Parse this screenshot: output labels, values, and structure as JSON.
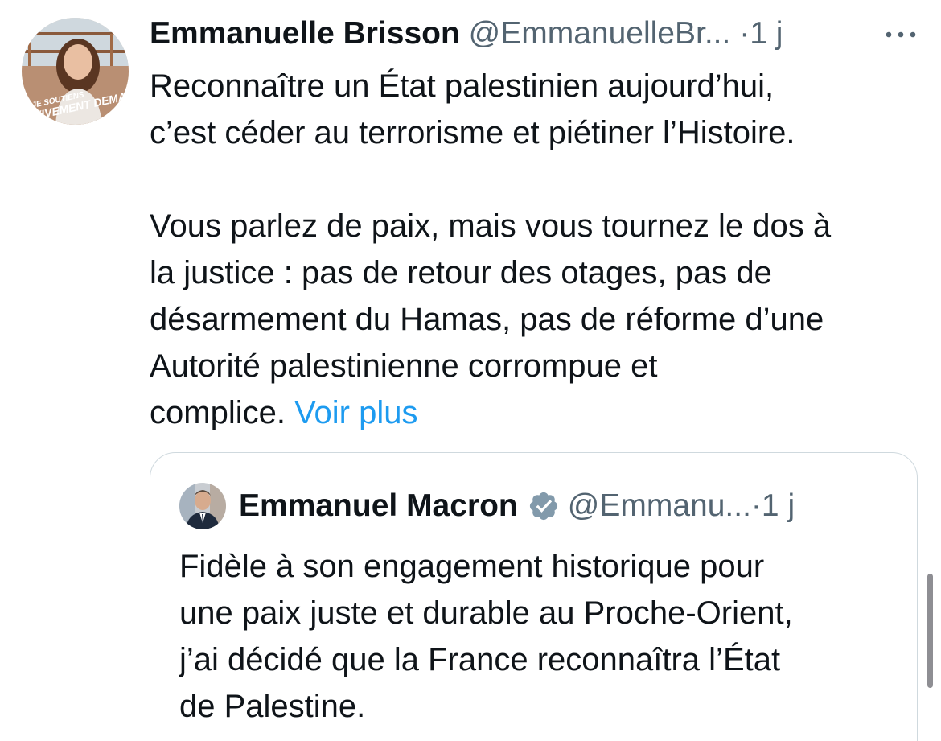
{
  "tweet": {
    "author_name": "Emmanuelle Brisson",
    "author_handle": "@EmmanuelleBr...",
    "separator": "·",
    "timestamp": "1 j",
    "avatar_banner": "JE SOUTIENS VIVEMENT DEMAIN !",
    "paragraph_1_line_1": "Reconnaître un État palestinien aujourd’hui,",
    "paragraph_1_line_2": "c’est céder au terrorisme et piétiner l’Histoire.",
    "paragraph_2_line_1": "Vous parlez de paix, mais vous tournez le dos à",
    "paragraph_2_line_2": "la justice : pas de retour des otages, pas de",
    "paragraph_2_line_3": "désarmement du Hamas, pas de réforme d’une",
    "paragraph_2_line_4": "Autorité palestinienne corrompue et",
    "paragraph_2_line_5": "complice.",
    "show_more_label": "Voir plus",
    "more_icon": "more-horizontal-icon"
  },
  "quoted_tweet": {
    "author_name": "Emmanuel Macron",
    "author_handle": "@Emmanu...",
    "separator": "·",
    "timestamp": "1 j",
    "verified_icon": "verified-badge-icon",
    "line_1": "Fidèle à son engagement historique pour",
    "line_2": "une paix juste et durable au Proche-Orient,",
    "line_3": "j’ai décidé que la France reconnaîtra l’État",
    "line_4": "de Palestine."
  },
  "colors": {
    "text_primary": "#0f1419",
    "text_secondary": "#536471",
    "link": "#1d9bf0",
    "card_border": "#cfd9de",
    "verified_badge": "#829aab"
  }
}
